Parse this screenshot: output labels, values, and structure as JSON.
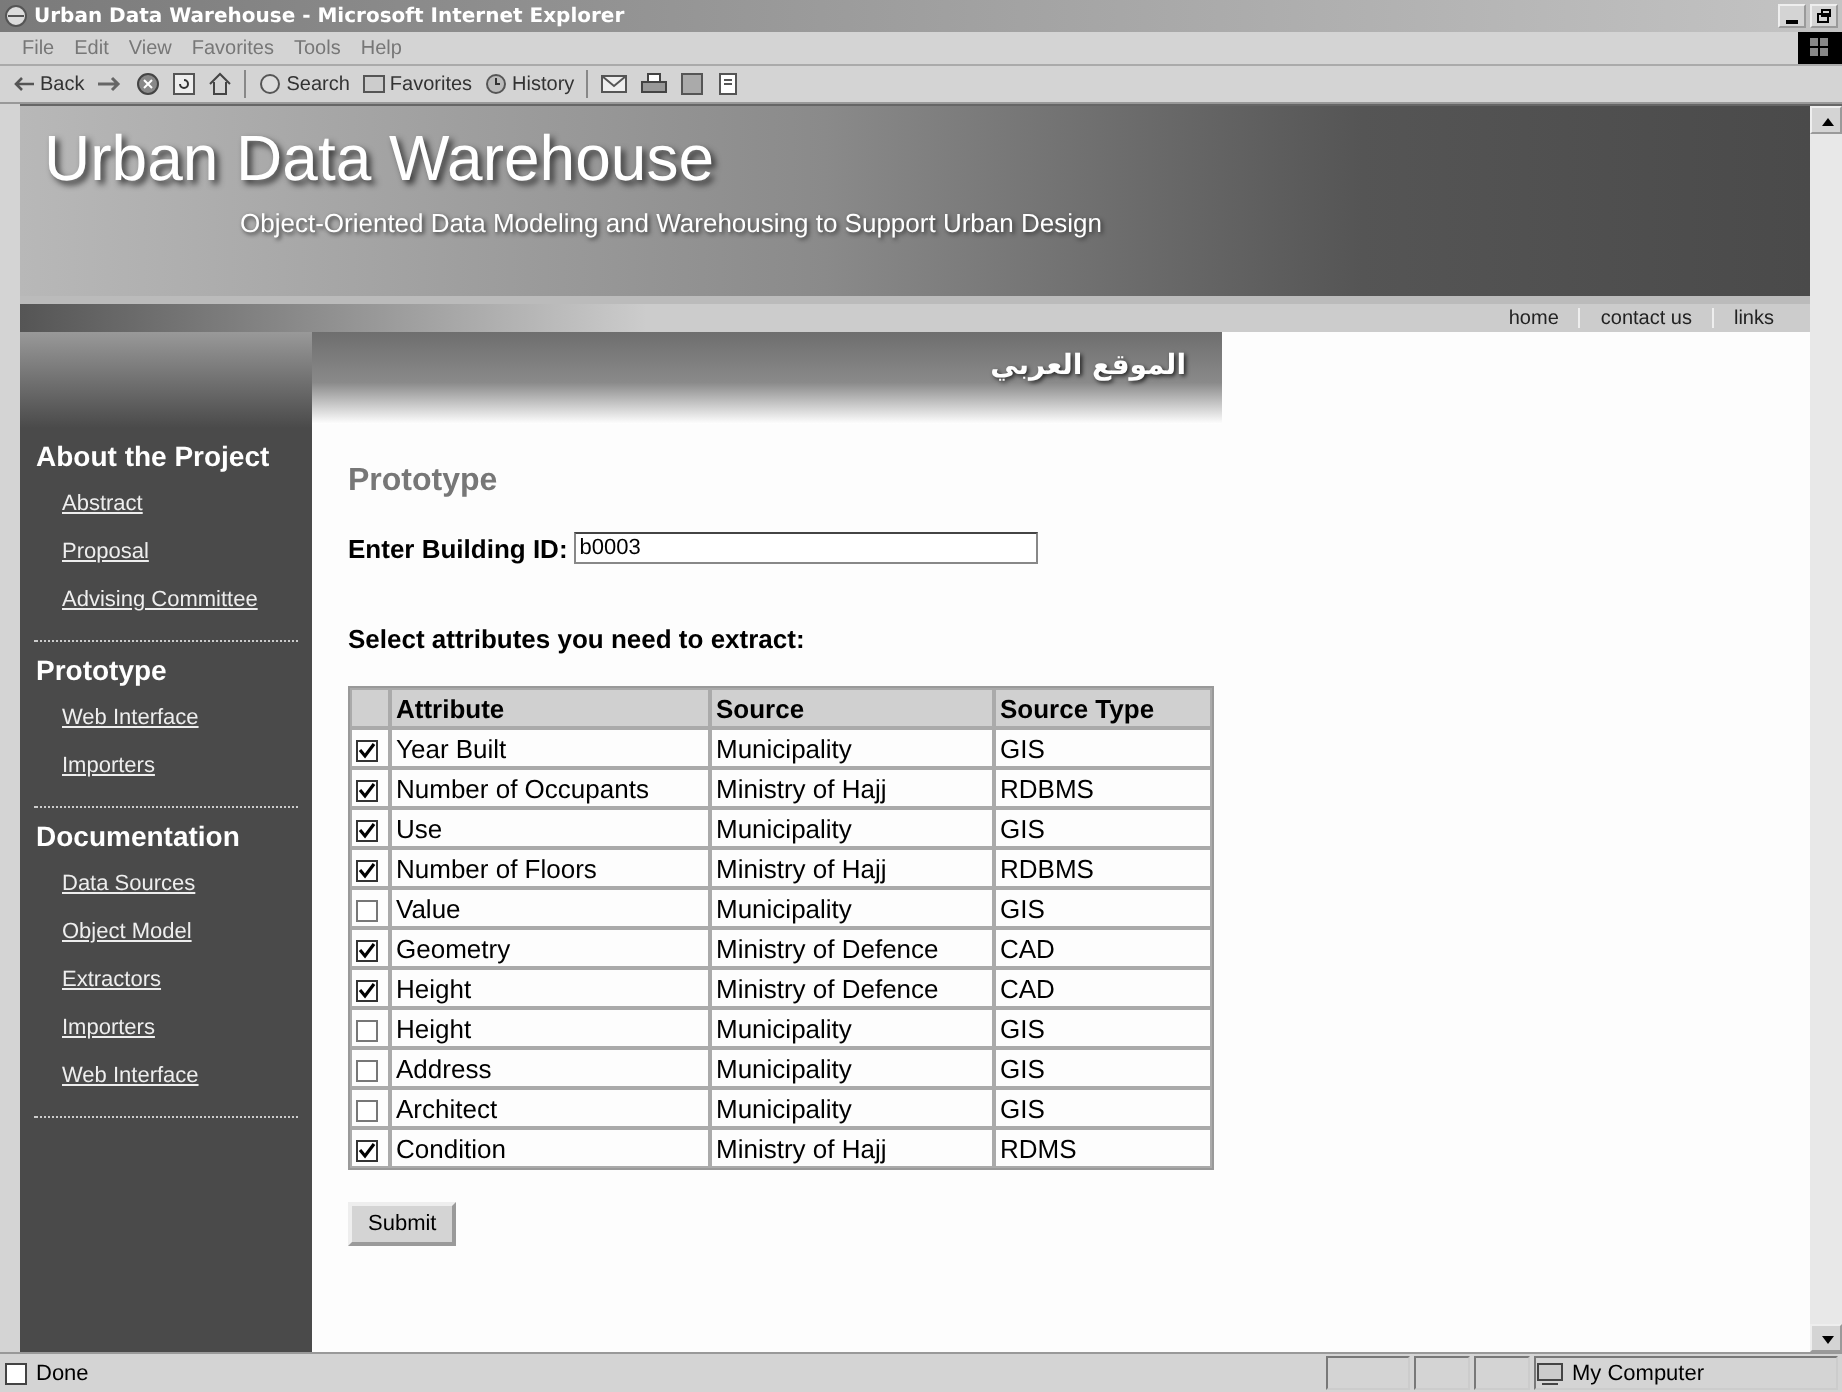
{
  "window": {
    "title": "Urban Data Warehouse - Microsoft Internet Explorer"
  },
  "menu": [
    "File",
    "Edit",
    "View",
    "Favorites",
    "Tools",
    "Help"
  ],
  "toolbar": {
    "back": "Back",
    "search": "Search",
    "favorites": "Favorites",
    "history": "History"
  },
  "header": {
    "title": "Urban Data Warehouse",
    "subtitle": "Object-Oriented Data Modeling and Warehousing to Support Urban Design"
  },
  "nav_links": [
    "home",
    "contact us",
    "links"
  ],
  "arabic_link": "الموقع العربي",
  "sidebar": {
    "sections": [
      {
        "heading": "About the Project",
        "links": [
          "Abstract",
          "Proposal",
          "Advising Committee"
        ]
      },
      {
        "heading": "Prototype",
        "links": [
          "Web Interface",
          "Importers"
        ]
      },
      {
        "heading": "Documentation",
        "links": [
          "Data Sources",
          "Object Model",
          "Extractors",
          "Importers",
          "Web Interface"
        ]
      }
    ]
  },
  "page_title": "Prototype",
  "building_id": {
    "label": "Enter Building ID:",
    "value": "b0003"
  },
  "instruction": "Select attributes you need to extract:",
  "table": {
    "columns": [
      "Attribute",
      "Source",
      "Source Type"
    ],
    "rows": [
      {
        "checked": true,
        "cells": [
          "Year Built",
          "Municipality",
          "GIS"
        ]
      },
      {
        "checked": true,
        "cells": [
          "Number of Occupants",
          "Ministry of Hajj",
          "RDBMS"
        ]
      },
      {
        "checked": true,
        "cells": [
          "Use",
          "Municipality",
          "GIS"
        ]
      },
      {
        "checked": true,
        "cells": [
          "Number of Floors",
          "Ministry of Hajj",
          "RDBMS"
        ]
      },
      {
        "checked": false,
        "cells": [
          "Value",
          "Municipality",
          "GIS"
        ]
      },
      {
        "checked": true,
        "cells": [
          "Geometry",
          "Ministry of Defence",
          "CAD"
        ]
      },
      {
        "checked": true,
        "cells": [
          "Height",
          "Ministry of Defence",
          "CAD"
        ]
      },
      {
        "checked": false,
        "cells": [
          "Height",
          "Municipality",
          "GIS"
        ]
      },
      {
        "checked": false,
        "cells": [
          "Address",
          "Municipality",
          "GIS"
        ]
      },
      {
        "checked": false,
        "cells": [
          "Architect",
          "Municipality",
          "GIS"
        ]
      },
      {
        "checked": true,
        "cells": [
          "Condition",
          "Ministry of Hajj",
          "RDMS"
        ]
      }
    ]
  },
  "submit": "Submit",
  "status_bar": {
    "text": "Done",
    "zone": "My Computer"
  }
}
